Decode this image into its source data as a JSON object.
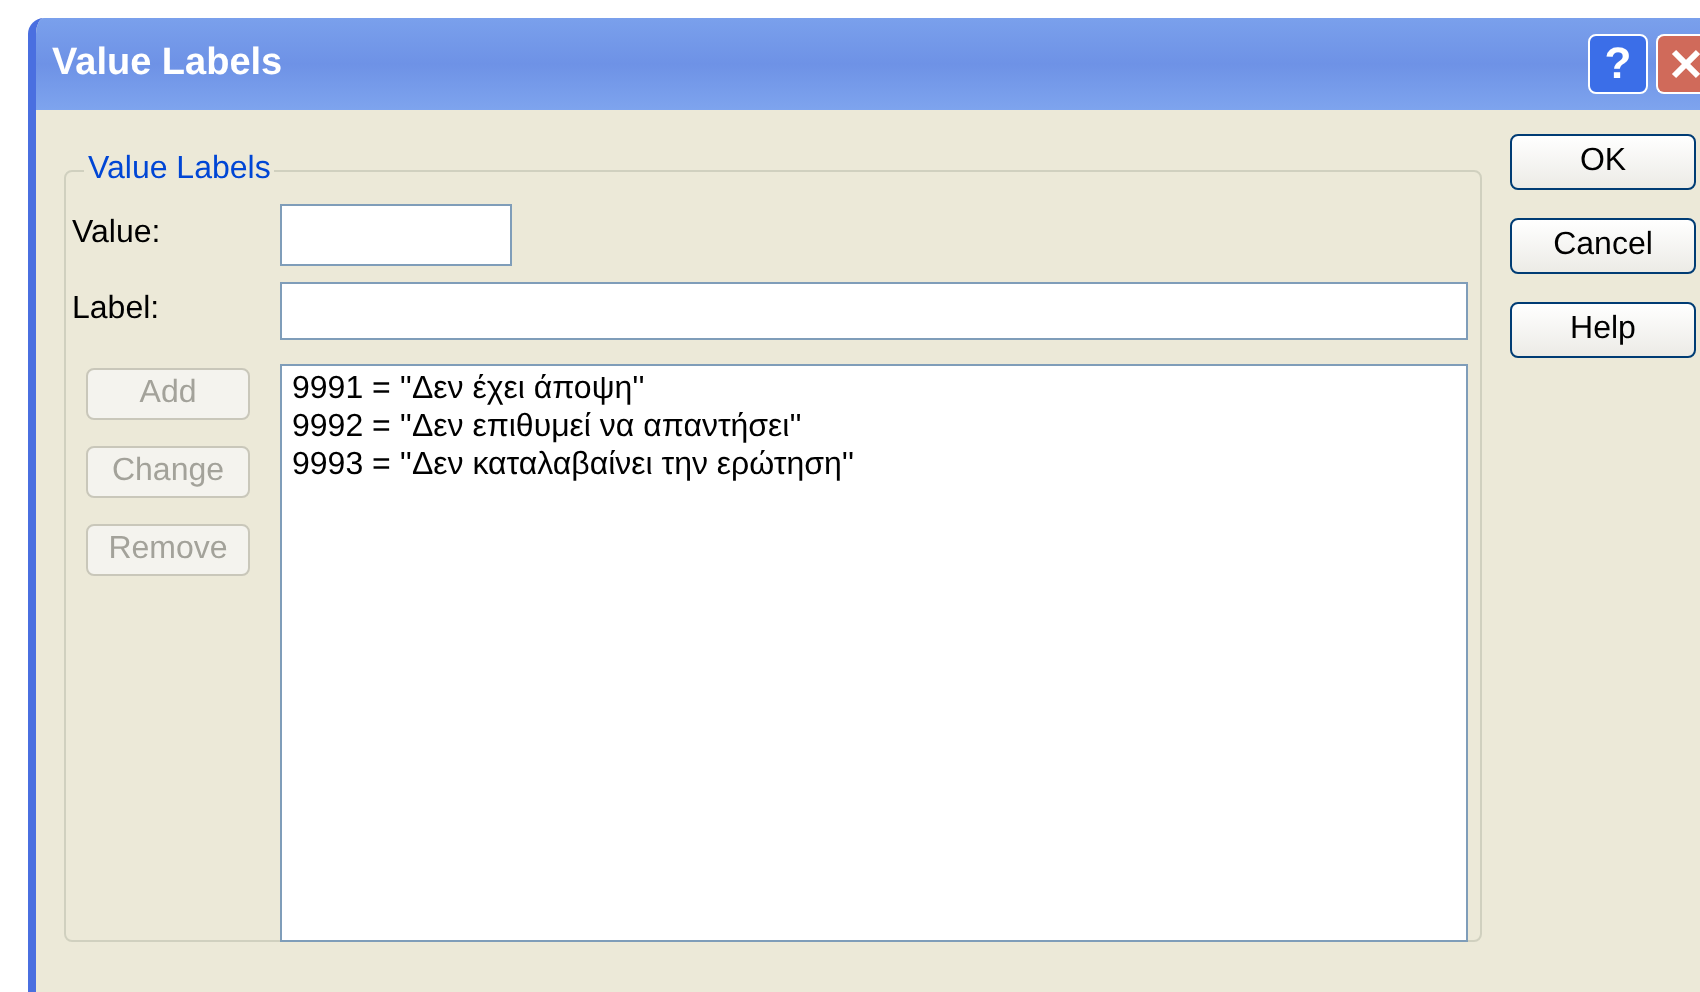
{
  "window": {
    "title": "Value Labels",
    "help_button": "?"
  },
  "group": {
    "title": "Value Labels",
    "value_field": {
      "label": "Value:"
    },
    "label_field": {
      "label": "Label:"
    },
    "buttons": [
      {
        "label": "Add",
        "disabled": true
      },
      {
        "label": "Change",
        "disabled": true
      },
      {
        "label": "Remove",
        "disabled": true
      }
    ],
    "list": [
      "9991 = ''Δεν έχει άποψη''",
      "9992 = ''Δεν επιθυμεί να απαντήσει''",
      "9993 = ''Δεν καταλαβαίνει την ερώτηση''"
    ]
  },
  "side_buttons": [
    {
      "label": "OK"
    },
    {
      "label": "Cancel"
    },
    {
      "label": "Help"
    }
  ]
}
